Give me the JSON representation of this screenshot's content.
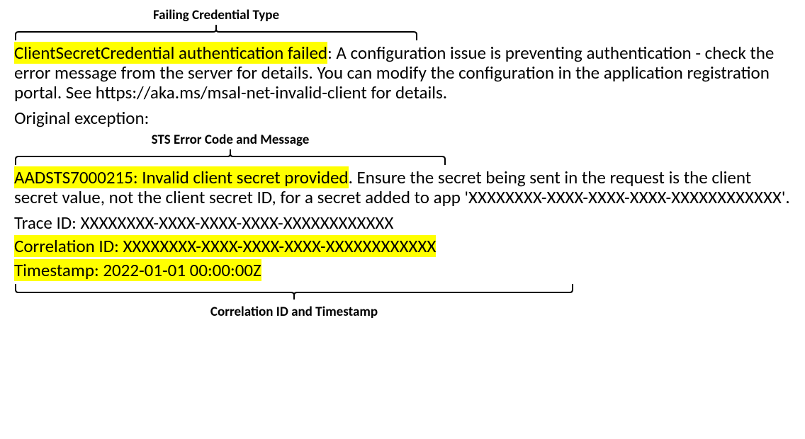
{
  "annotations": {
    "credential_type": "Failing Credential Type",
    "sts_error": "STS Error Code and Message",
    "correlation": "Correlation ID and Timestamp"
  },
  "error": {
    "highlighted_header": "ClientSecretCredential authentication failed",
    "header_rest": ": A configuration issue is preventing authentication - check the error message from the server for details. You can modify the configuration in the application registration portal. See https://aka.ms/msal-net-invalid-client for details.",
    "original_exception_label": "Original exception:",
    "sts_highlight": "AADSTS7000215: Invalid client secret provided",
    "sts_rest": ". Ensure the secret being sent in the request is the client secret value, not the client secret ID, for a secret added to app 'XXXXXXXX-XXXX-XXXX-XXXX-XXXXXXXXXXXX'.",
    "trace_id": "Trace ID: XXXXXXXX-XXXX-XXXX-XXXX-XXXXXXXXXXXX",
    "correlation_id": "Correlation ID: XXXXXXXX-XXXX-XXXX-XXXX-XXXXXXXXXXXX",
    "timestamp": "Timestamp: 2022-01-01 00:00:00Z"
  }
}
